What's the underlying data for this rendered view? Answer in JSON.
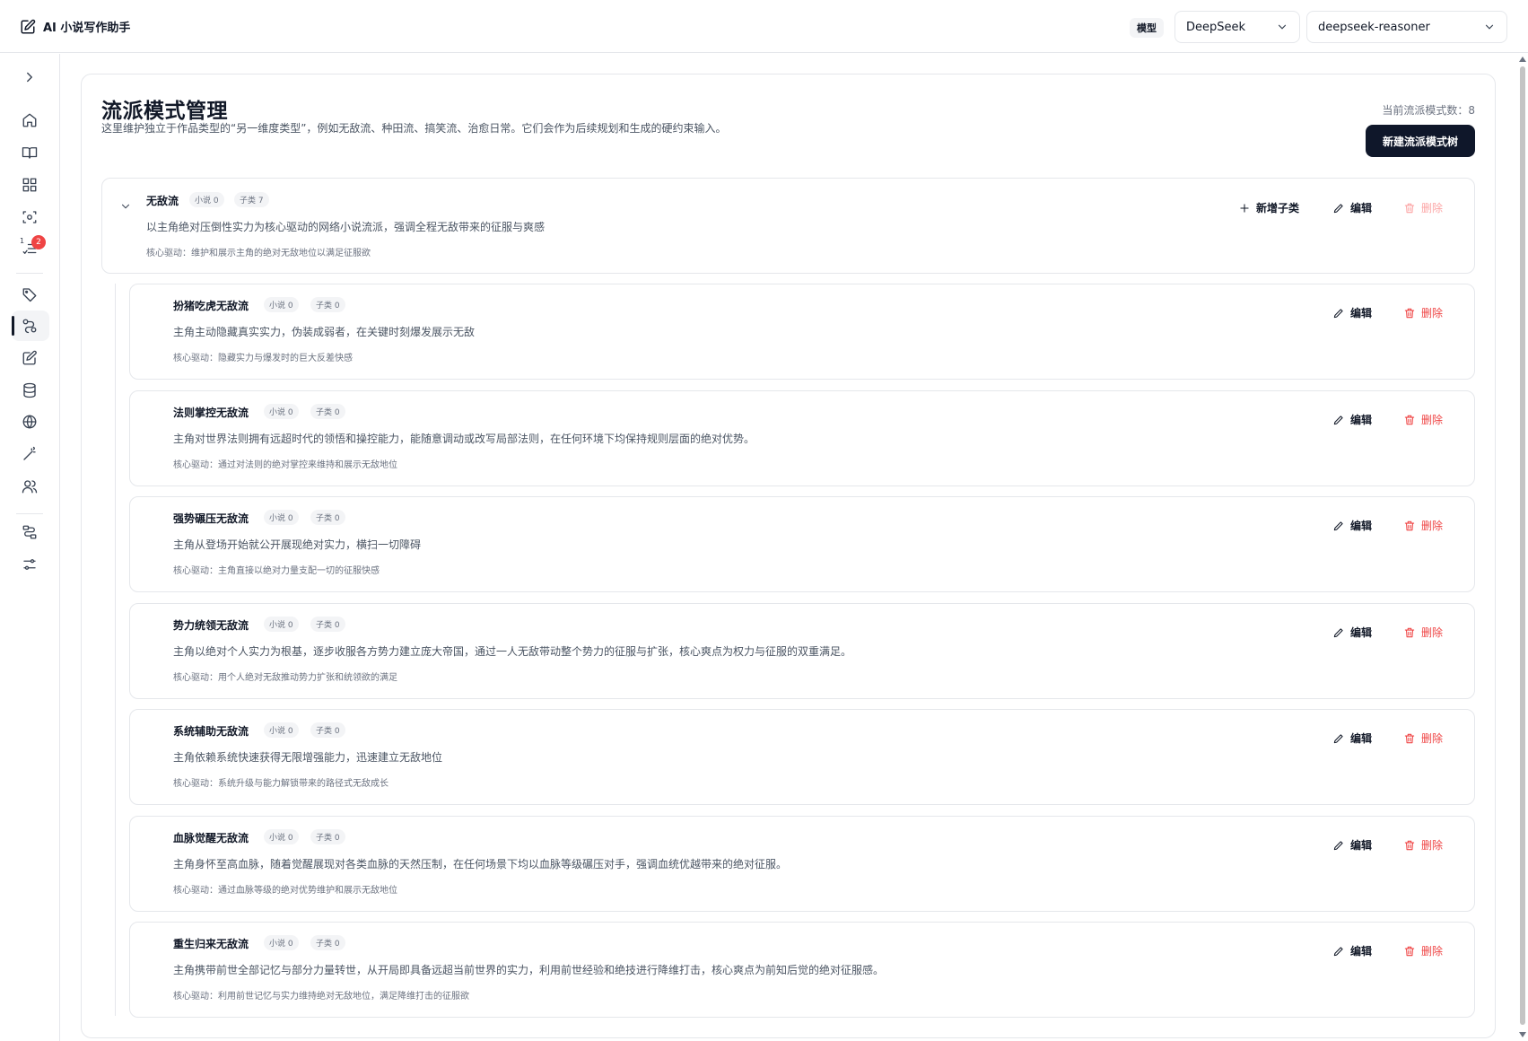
{
  "header": {
    "app_title": "AI 小说写作助手",
    "model_label": "模型",
    "provider": "DeepSeek",
    "model": "deepseek-reasoner"
  },
  "sidebar": {
    "badge_count": "2",
    "badge_index": "1",
    "icons": [
      "chevron-right-icon",
      "home-icon",
      "book-open-icon",
      "grid-icon",
      "scan-icon",
      "list-check-icon",
      "tag-icon",
      "route-icon",
      "edit-icon",
      "database-icon",
      "globe-icon",
      "wand-icon",
      "users-icon",
      "flow-icon",
      "sliders-icon"
    ]
  },
  "page": {
    "title": "流派模式管理",
    "description": "这里维护独立于作品类型的“另一维度类型”，例如无敌流、种田流、搞笑流、治愈日常。它们会作为后续规划和生成的硬约束输入。",
    "count_text": "当前流派模式数：8",
    "new_button": "新建流派模式树"
  },
  "root": {
    "name": "无敌流",
    "novels": "小说 0",
    "children": "子类 7",
    "desc": "以主角绝对压倒性实力为核心驱动的网络小说流派，强调全程无敌带来的征服与爽感",
    "core": "核心驱动：维护和展示主角的绝对无敌地位以满足征服欲",
    "add_child": "新增子类",
    "edit": "编辑",
    "delete": "删除"
  },
  "children": [
    {
      "name": "扮猪吃虎无敌流",
      "novels": "小说 0",
      "sub": "子类 0",
      "desc": "主角主动隐藏真实实力，伪装成弱者，在关键时刻爆发展示无敌",
      "core": "核心驱动：隐藏实力与爆发时的巨大反差快感",
      "edit": "编辑",
      "delete": "删除"
    },
    {
      "name": "法则掌控无敌流",
      "novels": "小说 0",
      "sub": "子类 0",
      "desc": "主角对世界法则拥有远超时代的领悟和操控能力，能随意调动或改写局部法则，在任何环境下均保持规则层面的绝对优势。",
      "core": "核心驱动：通过对法则的绝对掌控来维持和展示无敌地位",
      "edit": "编辑",
      "delete": "删除"
    },
    {
      "name": "强势碾压无敌流",
      "novels": "小说 0",
      "sub": "子类 0",
      "desc": "主角从登场开始就公开展现绝对实力，横扫一切障碍",
      "core": "核心驱动：主角直接以绝对力量支配一切的征服快感",
      "edit": "编辑",
      "delete": "删除"
    },
    {
      "name": "势力统领无敌流",
      "novels": "小说 0",
      "sub": "子类 0",
      "desc": "主角以绝对个人实力为根基，逐步收服各方势力建立庞大帝国，通过一人无敌带动整个势力的征服与扩张，核心爽点为权力与征服的双重满足。",
      "core": "核心驱动：用个人绝对无敌推动势力扩张和统领欲的满足",
      "edit": "编辑",
      "delete": "删除"
    },
    {
      "name": "系统辅助无敌流",
      "novels": "小说 0",
      "sub": "子类 0",
      "desc": "主角依赖系统快速获得无限增强能力，迅速建立无敌地位",
      "core": "核心驱动：系统升级与能力解锁带来的路径式无敌成长",
      "edit": "编辑",
      "delete": "删除"
    },
    {
      "name": "血脉觉醒无敌流",
      "novels": "小说 0",
      "sub": "子类 0",
      "desc": "主角身怀至高血脉，随着觉醒展现对各类血脉的天然压制，在任何场景下均以血脉等级碾压对手，强调血统优越带来的绝对征服。",
      "core": "核心驱动：通过血脉等级的绝对优势维护和展示无敌地位",
      "edit": "编辑",
      "delete": "删除"
    },
    {
      "name": "重生归来无敌流",
      "novels": "小说 0",
      "sub": "子类 0",
      "desc": "主角携带前世全部记忆与部分力量转世，从开局即具备远超当前世界的实力，利用前世经验和绝技进行降维打击，核心爽点为前知后觉的绝对征服感。",
      "core": "核心驱动：利用前世记忆与实力维持绝对无敌地位，满足降维打击的征服欲",
      "edit": "编辑",
      "delete": "删除"
    }
  ]
}
